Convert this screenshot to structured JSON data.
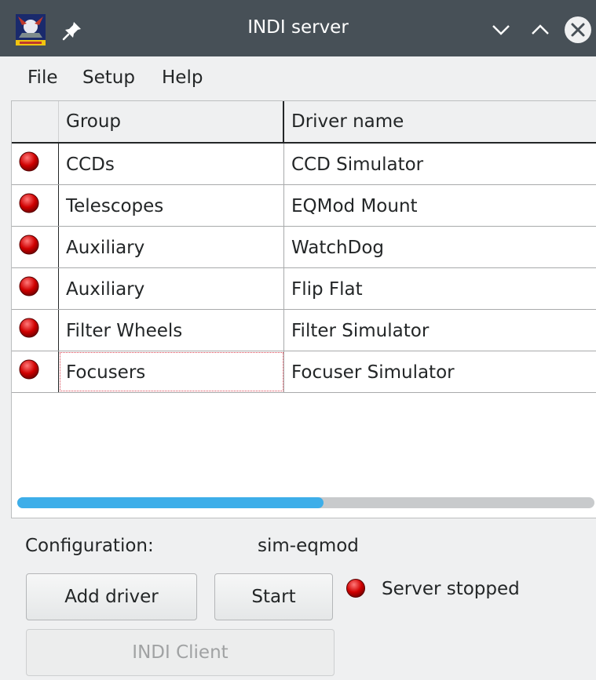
{
  "window": {
    "title": "INDI server",
    "icons": {
      "app": "kstars-app-icon",
      "pin": "pin-icon",
      "minimize": "chevron-down-icon",
      "maximize": "chevron-up-icon",
      "close": "close-icon"
    }
  },
  "menu": {
    "file": "File",
    "setup": "Setup",
    "help": "Help"
  },
  "table": {
    "columns": [
      "",
      "Group",
      "Driver name"
    ],
    "rows": [
      {
        "status": "stopped",
        "group": "CCDs",
        "driver": "CCD Simulator"
      },
      {
        "status": "stopped",
        "group": "Telescopes",
        "driver": "EQMod Mount"
      },
      {
        "status": "stopped",
        "group": "Auxiliary",
        "driver": "WatchDog"
      },
      {
        "status": "stopped",
        "group": "Auxiliary",
        "driver": "Flip Flat"
      },
      {
        "status": "stopped",
        "group": "Filter Wheels",
        "driver": "Filter Simulator"
      },
      {
        "status": "stopped",
        "group": "Focusers",
        "driver": "Focuser Simulator"
      }
    ],
    "focused_row": 5,
    "horizontal_scroll_fraction": 0.53
  },
  "config": {
    "label": "Configuration:",
    "value": "sim-eqmod"
  },
  "buttons": {
    "add_driver": "Add driver",
    "start": "Start",
    "indi_client": "INDI Client"
  },
  "server": {
    "status_text": "Server stopped",
    "status_color": "#d00000"
  },
  "colors": {
    "titlebar": "#475057",
    "accent": "#3daee9",
    "led_red": "#d00000"
  }
}
